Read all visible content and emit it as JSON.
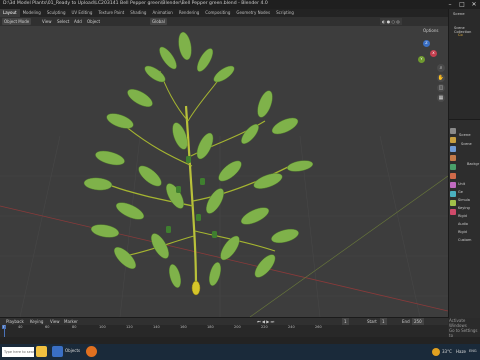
{
  "window": {
    "title": "D:\\3d Model Plants\\01_Ready to Upload\\LC203141 Bell Pepper green\\Blender\\Bell Pepper green.blend - Blender 4.0",
    "minimize": "–",
    "maximize": "□",
    "close": "✕"
  },
  "workspace_tabs": [
    "Layout",
    "Modeling",
    "Sculpting",
    "UV Editing",
    "Texture Paint",
    "Shading",
    "Animation",
    "Rendering",
    "Compositing",
    "Geometry Nodes",
    "Scripting"
  ],
  "viewport_header": {
    "mode": "Object Mode",
    "menus": [
      "View",
      "Select",
      "Add",
      "Object"
    ],
    "orientation": "Global",
    "options": "Options"
  },
  "gizmo": {
    "x": "X",
    "y": "Y",
    "z": "Z"
  },
  "outliner": {
    "title": "Scene",
    "collection": "Scene Collection",
    "item": "Co"
  },
  "properties": {
    "header": "Scene",
    "section": "Scene",
    "background_label": "Backgr",
    "rows": [
      "Unit",
      "Ge",
      "Simula",
      "Keying",
      "Rigid",
      "Audio",
      "Rigid",
      "Custom"
    ]
  },
  "timeline": {
    "menu": [
      "Playback",
      "Keying",
      "View",
      "Marker"
    ],
    "ticks": [
      "0",
      "40",
      "60",
      "80",
      "100",
      "120",
      "140",
      "160",
      "180",
      "200",
      "220",
      "240",
      "260"
    ],
    "current_frame": "1",
    "start": "1",
    "end": "250",
    "start_label": "Start",
    "end_label": "End"
  },
  "status": {
    "activate_line1": "Activate Windows",
    "activate_line2": "Go to Settings to"
  },
  "taskbar": {
    "search_placeholder": "Type here to search",
    "objects_label": "Objects",
    "temperature": "33°C",
    "weather": "Haze",
    "lang": "ENG"
  }
}
